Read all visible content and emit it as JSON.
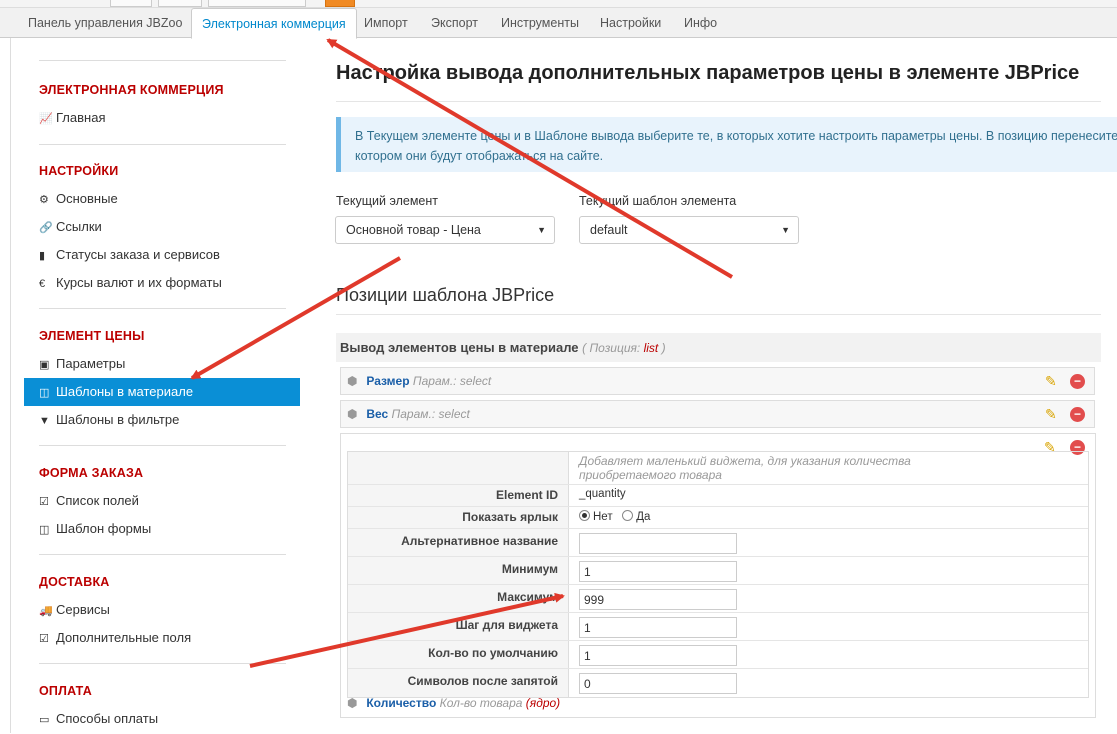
{
  "tabs": [
    {
      "label": "Панель управления JBZoo"
    },
    {
      "label": "Электронная коммерция"
    },
    {
      "label": "Импорт"
    },
    {
      "label": "Экспорт"
    },
    {
      "label": "Инструменты"
    },
    {
      "label": "Настройки"
    },
    {
      "label": "Инфо"
    }
  ],
  "sidebar": {
    "sections": [
      {
        "title": "ЭЛЕКТРОННАЯ КОММЕРЦИЯ",
        "items": [
          {
            "label": "Главная",
            "icon": "chart-icon"
          }
        ]
      },
      {
        "title": "НАСТРОЙКИ",
        "items": [
          {
            "label": "Основные",
            "icon": "gear-icon"
          },
          {
            "label": "Ссылки",
            "icon": "link-icon"
          },
          {
            "label": "Статусы заказа и сервисов",
            "icon": "bookmark-icon"
          },
          {
            "label": "Курсы валют и их форматы",
            "icon": "euro-icon"
          }
        ]
      },
      {
        "title": "ЭЛЕМЕНТ ЦЕНЫ",
        "items": [
          {
            "label": "Параметры",
            "icon": "money-icon"
          },
          {
            "label": "Шаблоны в материале",
            "icon": "columns-icon",
            "active": true
          },
          {
            "label": "Шаблоны в фильтре",
            "icon": "filter-icon"
          }
        ]
      },
      {
        "title": "ФОРМА ЗАКАЗА",
        "items": [
          {
            "label": "Список полей",
            "icon": "checkbox-icon"
          },
          {
            "label": "Шаблон формы",
            "icon": "columns-icon"
          }
        ]
      },
      {
        "title": "ДОСТАВКА",
        "items": [
          {
            "label": "Сервисы",
            "icon": "truck-icon"
          },
          {
            "label": "Дополнительные поля",
            "icon": "checkbox-icon"
          }
        ]
      },
      {
        "title": "ОПЛАТА",
        "items": [
          {
            "label": "Способы оплаты",
            "icon": "credit-card-icon"
          }
        ]
      }
    ]
  },
  "main": {
    "title": "Настройка вывода дополнительных параметров цены в элементе JBPrice",
    "info_line1": "В Текущем элементе цены и в Шаблоне вывода выберите те, в которых хотите настроить параметры цены. В позицию перенесите элементы",
    "info_line2": "котором они будут отображаться на сайте.",
    "current_element_label": "Текущий элемент",
    "current_element_value": "Основной товар - Цена",
    "current_template_label": "Текущий шаблон элемента",
    "current_template_value": "default",
    "positions_title": "Позиции шаблона JBPrice",
    "position_header": "Вывод элементов цены в материале",
    "position_hint_prefix": "( Позиция: ",
    "position_hint_name": "list",
    "position_hint_suffix": " )",
    "elements": [
      {
        "name": "Размер",
        "param": "Парам.: select"
      },
      {
        "name": "Вес",
        "param": "Парам.: select"
      }
    ],
    "expanded": {
      "description": "Добавляет маленький виджета, для указания количества приобретаемого товара",
      "rows": {
        "element_id_label": "Element ID",
        "element_id_value": "_quantity",
        "show_label_label": "Показать ярлык",
        "show_label_opt_no": "Нет",
        "show_label_opt_yes": "Да",
        "alt_name_label": "Альтернативное название",
        "alt_name_value": "",
        "min_label": "Минимум",
        "min_value": "1",
        "max_label": "Максимум",
        "max_value": "999",
        "step_label": "Шаг для виджета",
        "step_value": "1",
        "default_label": "Кол-во по умолчанию",
        "default_value": "1",
        "decimals_label": "Символов после запятой",
        "decimals_value": "0"
      },
      "footer_name": "Количество",
      "footer_param": "Кол-во товара",
      "footer_core": "(ядро)"
    }
  },
  "colors": {
    "accent": "#0a8fd6",
    "section_title": "#bb0000",
    "arrow": "#e0392b"
  }
}
